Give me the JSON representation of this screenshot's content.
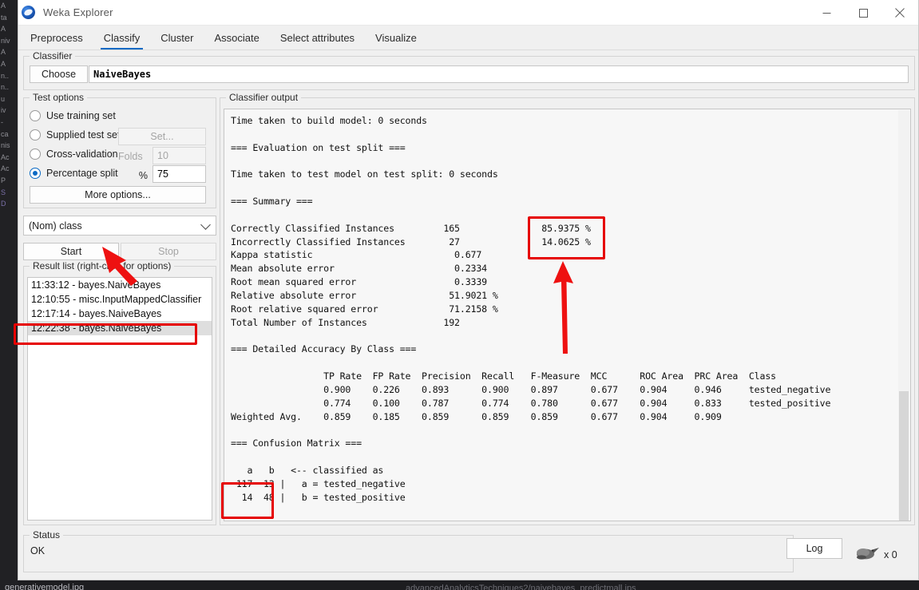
{
  "desktop": {
    "left_strip": [
      "A",
      "ta",
      "A",
      "niv",
      "A",
      "A",
      "n..",
      "n..",
      "u",
      "iv",
      "-",
      "ca",
      "nis",
      "Ac",
      "Ac",
      "P",
      "",
      "",
      "",
      "",
      "",
      "",
      "",
      "",
      "",
      "",
      "",
      "",
      "",
      "",
      "",
      "",
      "",
      "",
      "",
      "",
      "",
      "",
      "",
      "",
      "",
      "",
      "",
      "",
      "S",
      "D"
    ],
    "bottom_left_filename": "generativemodel.jpg",
    "bottom_center_path": "advancedAnalyticsTechniques2/naivebayes_predictmall.jps"
  },
  "window": {
    "title": "Weka Explorer",
    "logo_icon": "weka-bird-logo-icon",
    "controls": {
      "minimize": "minimize-icon",
      "maximize": "maximize-icon",
      "close": "close-icon"
    }
  },
  "tabs": [
    {
      "label": "Preprocess",
      "active": false
    },
    {
      "label": "Classify",
      "active": true
    },
    {
      "label": "Cluster",
      "active": false
    },
    {
      "label": "Associate",
      "active": false
    },
    {
      "label": "Select attributes",
      "active": false
    },
    {
      "label": "Visualize",
      "active": false
    }
  ],
  "classifier": {
    "group_title": "Classifier",
    "choose_label": "Choose",
    "selected": "NaiveBayes"
  },
  "test_options": {
    "group_title": "Test options",
    "options": [
      {
        "label": "Use training set",
        "selected": false
      },
      {
        "label": "Supplied test set",
        "selected": false
      },
      {
        "label": "Cross-validation",
        "selected": false
      },
      {
        "label": "Percentage split",
        "selected": true
      }
    ],
    "set_button": "Set...",
    "folds_label": "Folds",
    "folds_value": "10",
    "percent_label": "%",
    "percent_value": "75",
    "more_options_button": "More options...",
    "class_combo_value": "(Nom) class",
    "class_combo_icon": "chevron-down-icon"
  },
  "actions": {
    "start_button": "Start",
    "stop_button": "Stop"
  },
  "result_list": {
    "title": "Result list (right-click for options)",
    "items": [
      {
        "label": "11:33:12 - bayes.NaiveBayes",
        "selected": false
      },
      {
        "label": "12:10:55 - misc.InputMappedClassifier",
        "selected": false
      },
      {
        "label": "12:17:14 - bayes.NaiveBayes",
        "selected": false
      },
      {
        "label": "12:22:38 - bayes.NaiveBayes",
        "selected": true
      }
    ]
  },
  "classifier_output": {
    "group_title": "Classifier output",
    "text": "Time taken to build model: 0 seconds\n\n=== Evaluation on test split ===\n\nTime taken to test model on test split: 0 seconds\n\n=== Summary ===\n\nCorrectly Classified Instances         165               85.9375 %\nIncorrectly Classified Instances        27               14.0625 %\nKappa statistic                          0.677\nMean absolute error                      0.2334\nRoot mean squared error                  0.3339\nRelative absolute error                 51.9021 %\nRoot relative squared error             71.2158 %\nTotal Number of Instances              192\n\n=== Detailed Accuracy By Class ===\n\n                 TP Rate  FP Rate  Precision  Recall   F-Measure  MCC      ROC Area  PRC Area  Class\n                 0.900    0.226    0.893      0.900    0.897      0.677    0.904     0.946     tested_negative\n                 0.774    0.100    0.787      0.774    0.780      0.677    0.904     0.833     tested_positive\nWeighted Avg.    0.859    0.185    0.859      0.859    0.859      0.677    0.904     0.909\n\n=== Confusion Matrix ===\n\n   a   b   <-- classified as\n 117  13 |   a = tested_negative\n  14  48 |   b = tested_positive",
    "scrollbar_icon": "vertical-scrollbar"
  },
  "metrics": {
    "correctly_classified_instances": {
      "label": "Correctly Classified Instances",
      "count": "165",
      "percent": "85.9375 %"
    },
    "incorrectly_classified_instances": {
      "label": "Incorrectly Classified Instances",
      "count": "27",
      "percent": "14.0625 %"
    },
    "kappa_statistic": "0.677",
    "mean_absolute_error": "0.2334",
    "root_mean_squared_error": "0.3339",
    "relative_absolute_error": "51.9021 %",
    "root_relative_squared_error": "71.2158 %",
    "total_number_of_instances": "192"
  },
  "detailed_accuracy": {
    "headers": [
      "TP Rate",
      "FP Rate",
      "Precision",
      "Recall",
      "F-Measure",
      "MCC",
      "ROC Area",
      "PRC Area",
      "Class"
    ],
    "rows": [
      {
        "row_label": "",
        "values": [
          "0.900",
          "0.226",
          "0.893",
          "0.900",
          "0.897",
          "0.677",
          "0.904",
          "0.946"
        ],
        "class": "tested_negative"
      },
      {
        "row_label": "",
        "values": [
          "0.774",
          "0.100",
          "0.787",
          "0.774",
          "0.780",
          "0.677",
          "0.904",
          "0.833"
        ],
        "class": "tested_positive"
      },
      {
        "row_label": "Weighted Avg.",
        "values": [
          "0.859",
          "0.185",
          "0.859",
          "0.859",
          "0.859",
          "0.677",
          "0.904",
          "0.909"
        ],
        "class": ""
      }
    ]
  },
  "confusion_matrix": {
    "col_headers": [
      "a",
      "b"
    ],
    "rows": [
      {
        "values": [
          "117",
          "13"
        ],
        "legend": "a = tested_negative"
      },
      {
        "values": [
          "14",
          "48"
        ],
        "legend": "b = tested_positive"
      }
    ],
    "caption": "<-- classified as"
  },
  "status": {
    "group_title": "Status",
    "value": "OK",
    "log_button": "Log",
    "bird_icon": "weka-bird-icon",
    "bird_count": "x 0"
  },
  "annotations": {
    "accent_color": "#e60000",
    "boxes": [
      {
        "name": "percent-metrics-highlight"
      },
      {
        "name": "result-list-selected-highlight"
      },
      {
        "name": "confusion-matrix-highlight"
      }
    ],
    "arrows": [
      {
        "name": "arrow-to-start-button"
      },
      {
        "name": "arrow-to-percent-metrics"
      }
    ]
  }
}
